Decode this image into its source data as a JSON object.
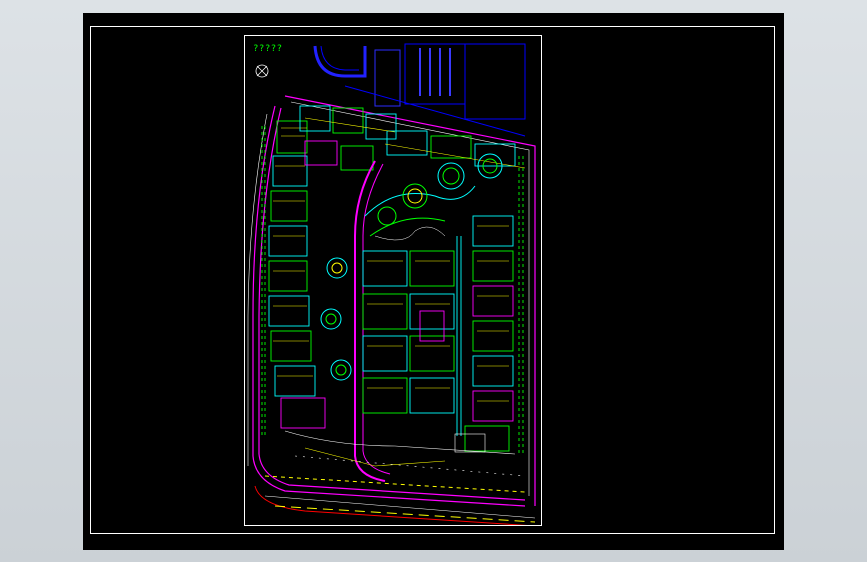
{
  "drawing": {
    "title": "?????"
  },
  "colors": {
    "background": "#000000",
    "frame": "#ffffff",
    "green": "#00ff00",
    "cyan": "#00ffff",
    "magenta": "#ff00ff",
    "yellow": "#ffff00",
    "blue": "#0000ff",
    "red": "#ff0000",
    "white": "#ffffff"
  }
}
